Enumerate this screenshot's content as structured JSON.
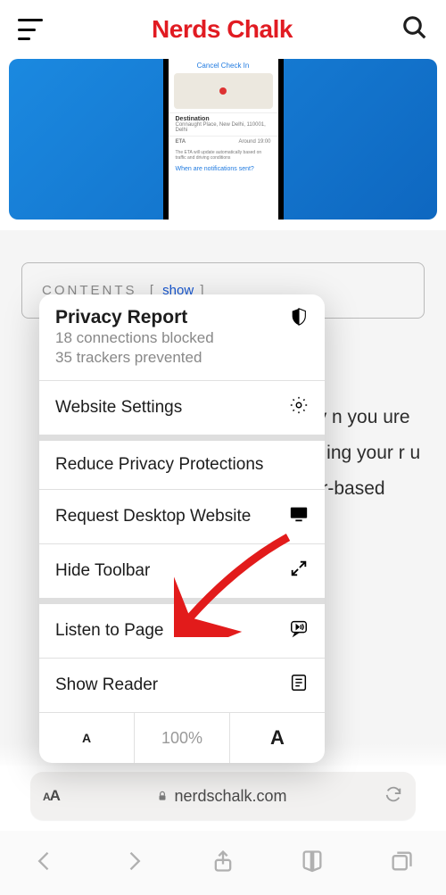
{
  "header": {
    "logo": "Nerds Chalk"
  },
  "phone": {
    "cancel": "Cancel Check In",
    "dest_label": "Destination",
    "dest_value": "Connaught Place, New Delhi, 110001, Delhi",
    "eta_label": "ETA",
    "eta_value": "Around 19:00",
    "eta_note": "The ETA will update automatically based on traffic and driving conditions",
    "link": "When are notifications sent?"
  },
  "toc": {
    "label": "CONTENTS",
    "action": "show"
  },
  "body_text": "notify n you ure aims ing your r u also r-based",
  "menu": {
    "privacy": {
      "title": "Privacy Report",
      "line1": "18 connections blocked",
      "line2": "35 trackers prevented"
    },
    "website_settings": "Website Settings",
    "reduce_privacy": "Reduce Privacy Protections",
    "request_desktop": "Request Desktop Website",
    "hide_toolbar": "Hide Toolbar",
    "listen": "Listen to Page",
    "show_reader": "Show Reader",
    "zoom": "100%"
  },
  "urlbar": {
    "domain": "nerdschalk.com"
  }
}
